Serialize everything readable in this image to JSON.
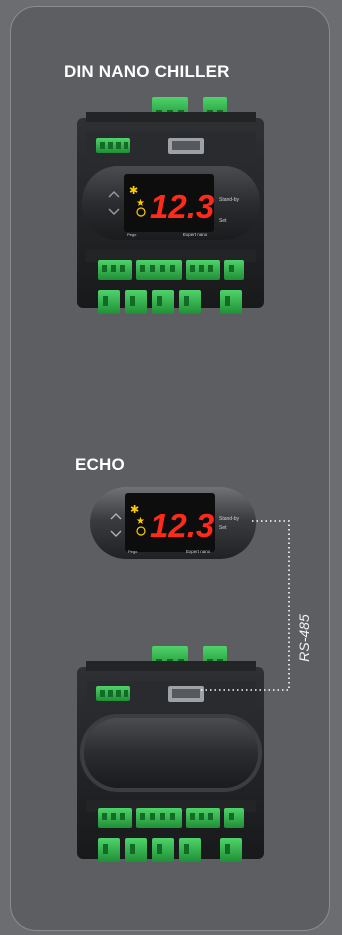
{
  "sections": [
    {
      "title": "DIN NANO CHILLER"
    },
    {
      "title": "ECHO"
    }
  ],
  "device": {
    "display_value": "12.3",
    "buttons": {
      "standby_label": "Stand-by",
      "set_label": "Set"
    },
    "brand": "Pego",
    "model": "Expert nano"
  },
  "connection_label": "RS-485",
  "colors": {
    "background": "#6b6d71",
    "panel": "#5c5e62",
    "display_red": "#ff2a1a",
    "indicator_yellow": "#ffcc00",
    "terminal_green": "#2fb24a",
    "housing": "#1f2022"
  }
}
